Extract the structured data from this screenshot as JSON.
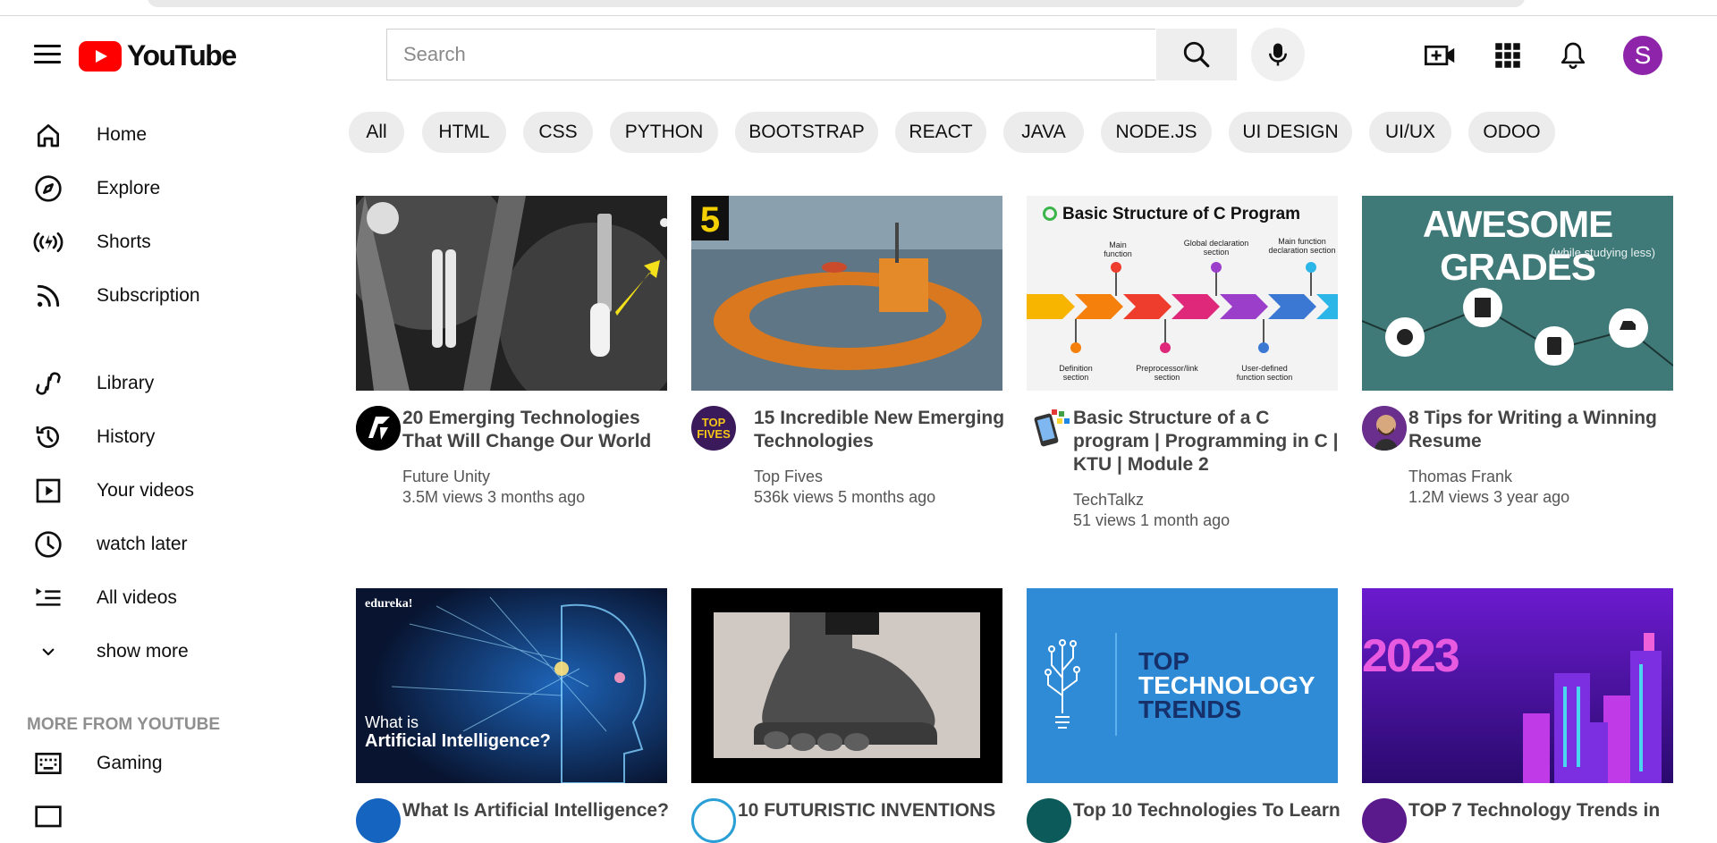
{
  "header": {
    "logo_text": "YouTube",
    "search_placeholder": "Search",
    "avatar_letter": "S",
    "icons": [
      "menu-icon",
      "search-icon",
      "mic-icon",
      "create-video-icon",
      "apps-icon",
      "bell-icon"
    ]
  },
  "sidebar": {
    "items": [
      {
        "label": "Home",
        "icon": "home-icon"
      },
      {
        "label": "Explore",
        "icon": "compass-icon"
      },
      {
        "label": "Shorts",
        "icon": "shorts-icon"
      },
      {
        "label": "Subscription",
        "icon": "rss-icon"
      },
      {
        "label": "Library",
        "icon": "library-icon"
      },
      {
        "label": "History",
        "icon": "history-icon"
      },
      {
        "label": "Your videos",
        "icon": "play-square-icon"
      },
      {
        "label": "watch later",
        "icon": "clock-icon"
      },
      {
        "label": "All videos",
        "icon": "playlist-icon"
      },
      {
        "label": "show more",
        "icon": "chevron-down-icon"
      }
    ],
    "section_title": "MORE FROM YOUTUBE",
    "more_items": [
      {
        "label": "Gaming",
        "icon": "gaming-icon"
      }
    ]
  },
  "chips": [
    "All",
    "HTML",
    "CSS",
    "PYTHON",
    "BOOTSTRAP",
    "REACT",
    "JAVA",
    "NODE.JS",
    "UI DESIGN",
    "UI/UX",
    "ODOO"
  ],
  "videos": [
    {
      "title": "20 Emerging Technologies That Will Change Our World",
      "channel": "Future Unity",
      "views": "3.5M views",
      "age": "3 months ago"
    },
    {
      "title": "15 Incredible New Emerging Technologies",
      "channel": "Top Fives",
      "views": "536k views",
      "age": "5 months ago",
      "avatar_text": "TOP FIVES",
      "thumb_badge": "5"
    },
    {
      "title": "Basic Structure of a C program | Programming in C | KTU | Module 2",
      "channel": "TechTalkz",
      "views": "51 views",
      "age": "1 month ago",
      "thumb_heading": "Basic Structure of C Program",
      "thumb_labels": [
        "Main function",
        "Global declaration section",
        "Main function declaration section",
        "Definition section",
        "Preprocessor/link section",
        "User-defined function section"
      ]
    },
    {
      "title": "8 Tips for Writing a Winning Resume",
      "channel": "Thomas Frank",
      "views": "1.2M views",
      "age": "3 year ago",
      "thumb_heading": "AWESOME GRADES",
      "thumb_sub": "(while studying less)"
    },
    {
      "title": "What Is Artificial Intelligence?",
      "thumb_brand": "edureka!",
      "thumb_line1": "What is",
      "thumb_line2": "Artificial Intelligence?"
    },
    {
      "title": "10 FUTURISTIC INVENTIONS"
    },
    {
      "title": "Top 10 Technologies To Learn",
      "thumb_lines": [
        "TOP",
        "TECHNOLOGY",
        "TRENDS"
      ]
    },
    {
      "title": "TOP 7 Technology Trends in",
      "thumb_year": "2023"
    }
  ],
  "colors": {
    "brand_red": "#ff0000",
    "avatar_purple": "#8e24aa",
    "chip_bg": "#ececec"
  }
}
